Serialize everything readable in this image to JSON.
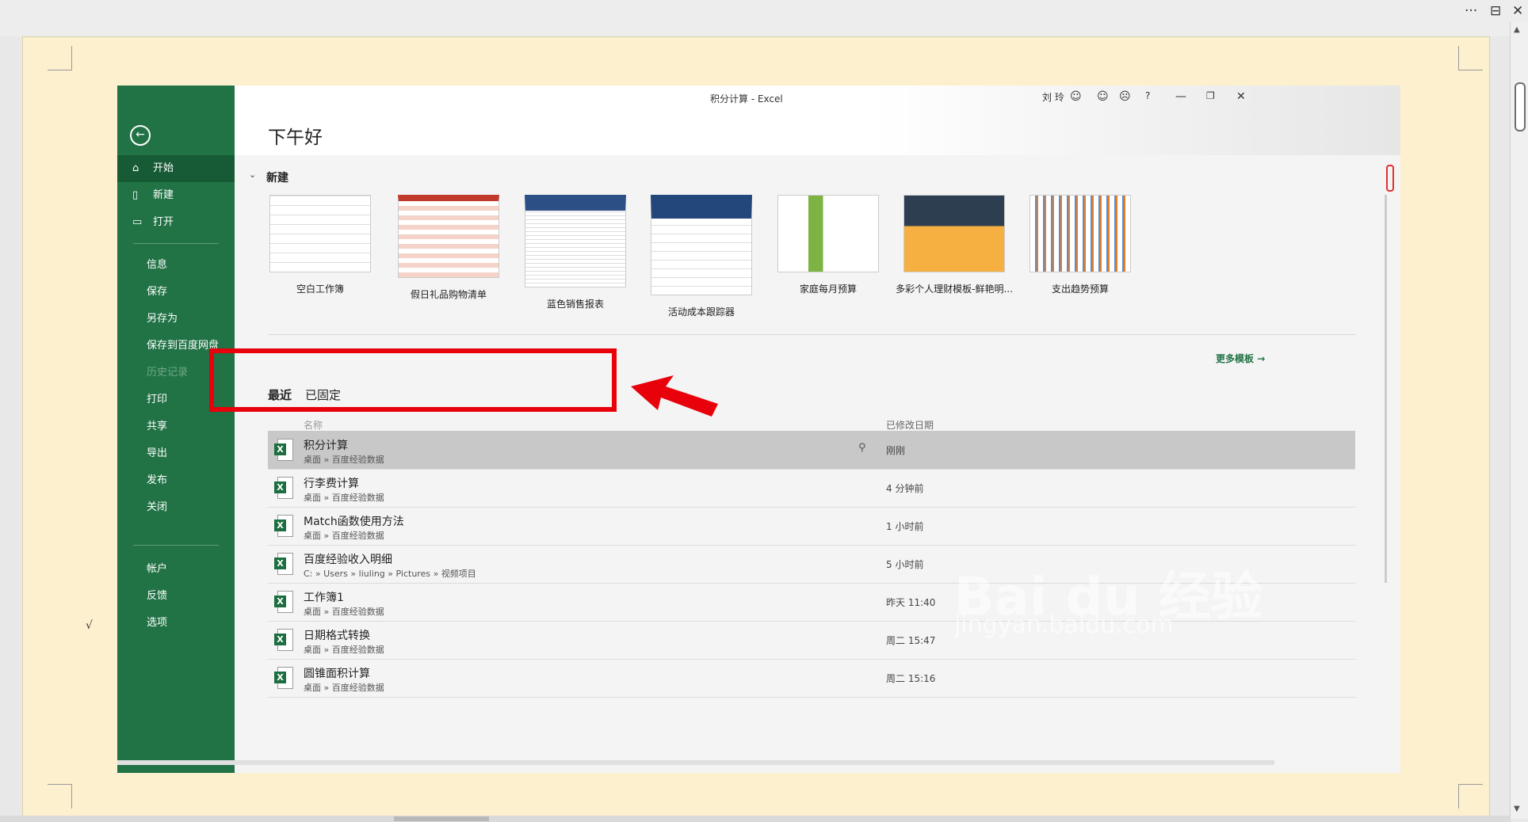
{
  "window": {
    "title": "积分计算  -  Excel",
    "user": "刘 玲"
  },
  "greeting": "下午好",
  "sidebar": {
    "items": [
      {
        "label": "开始",
        "icon": "home-icon"
      },
      {
        "label": "新建",
        "icon": "new-doc-icon"
      },
      {
        "label": "打开",
        "icon": "folder-open-icon"
      },
      {
        "label": "信息"
      },
      {
        "label": "保存"
      },
      {
        "label": "另存为"
      },
      {
        "label": "保存到百度网盘"
      },
      {
        "label": "历史记录"
      },
      {
        "label": "打印"
      },
      {
        "label": "共享"
      },
      {
        "label": "导出"
      },
      {
        "label": "发布"
      },
      {
        "label": "关闭"
      },
      {
        "label": "帐户"
      },
      {
        "label": "反馈"
      },
      {
        "label": "选项"
      }
    ]
  },
  "new_section": {
    "title": "新建",
    "templates": [
      "空白工作簿",
      "假日礼品购物清单",
      "蓝色销售报表",
      "活动成本跟踪器",
      "家庭每月预算",
      "多彩个人理财模板-鲜艳明...",
      "支出趋势预算"
    ],
    "more_label": "更多模板"
  },
  "tabs": [
    "最近",
    "已固定"
  ],
  "columns": {
    "name": "名称",
    "modified": "已修改日期"
  },
  "files": [
    {
      "name": "积分计算",
      "path": "桌面 » 百度经验数据",
      "modified": "刚刚"
    },
    {
      "name": "行李费计算",
      "path": "桌面 » 百度经验数据",
      "modified": "4 分钟前"
    },
    {
      "name": "Match函数使用方法",
      "path": "桌面 » 百度经验数据",
      "modified": "1 小时前"
    },
    {
      "name": "百度经验收入明细",
      "path": "C: » Users » liuling » Pictures » 视频项目",
      "modified": "5 小时前"
    },
    {
      "name": "工作簿1",
      "path": "桌面 » 百度经验数据",
      "modified": "昨天 11:40"
    },
    {
      "name": "日期格式转换",
      "path": "桌面 » 百度经验数据",
      "modified": "周二 15:47"
    },
    {
      "name": "圆锥面积计算",
      "path": "桌面 » 百度经验数据",
      "modified": "周二 15:16"
    }
  ],
  "watermark": {
    "line1": "Bai du 经验",
    "line2": "jingyan.baidu.com"
  },
  "colors": {
    "excel_green": "#217346",
    "annotation_red": "#e8000b"
  }
}
